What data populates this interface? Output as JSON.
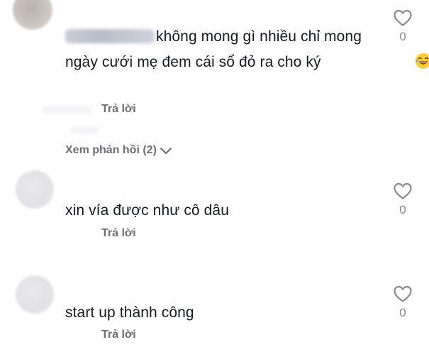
{
  "comments": [
    {
      "text": "không mong gì nhiều chỉ mong ngày cưới mẹ đem cái sổ đỏ ra cho ký",
      "emoji": "laughing-tears-emoji",
      "reply_label": "Trả lời",
      "view_replies_label": "Xem phản hồi (2)",
      "like_count": "0"
    },
    {
      "text": "xin vía được như cô dâu",
      "reply_label": "Trả lời",
      "like_count": "0"
    },
    {
      "text": "start up thành công",
      "reply_label": "Trả lời",
      "like_count": "0"
    }
  ],
  "icons": {
    "like": "heart-outline-icon",
    "expand": "chevron-down-icon"
  },
  "colors": {
    "text": "#161823",
    "secondary": "#6d6e75",
    "count": "#8a8b91"
  }
}
